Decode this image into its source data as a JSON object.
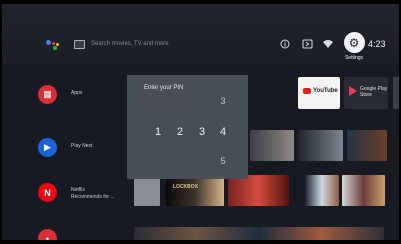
{
  "topbar": {
    "search_placeholder": "Search movies, TV and more",
    "settings_label": "Settings",
    "time": "4:23"
  },
  "rows": [
    {
      "label": "Apps"
    },
    {
      "label": "Play Next"
    },
    {
      "label": "Netflix\nRecommends for ..."
    }
  ],
  "apps": {
    "youtube": "YouTube",
    "play_store": "Google Play Store"
  },
  "pin_dialog": {
    "title": "Enter your PIN",
    "digits": [
      "1",
      "2",
      "3",
      "4"
    ],
    "above_digit": "3",
    "below_digit": "5"
  },
  "posters": {
    "lockbox_title": "LOCKBOX"
  },
  "icons": {
    "assistant": "assistant-icon",
    "input": "input-icon",
    "wifi": "wifi-icon",
    "settings": "gear-icon",
    "info": "info-icon"
  }
}
